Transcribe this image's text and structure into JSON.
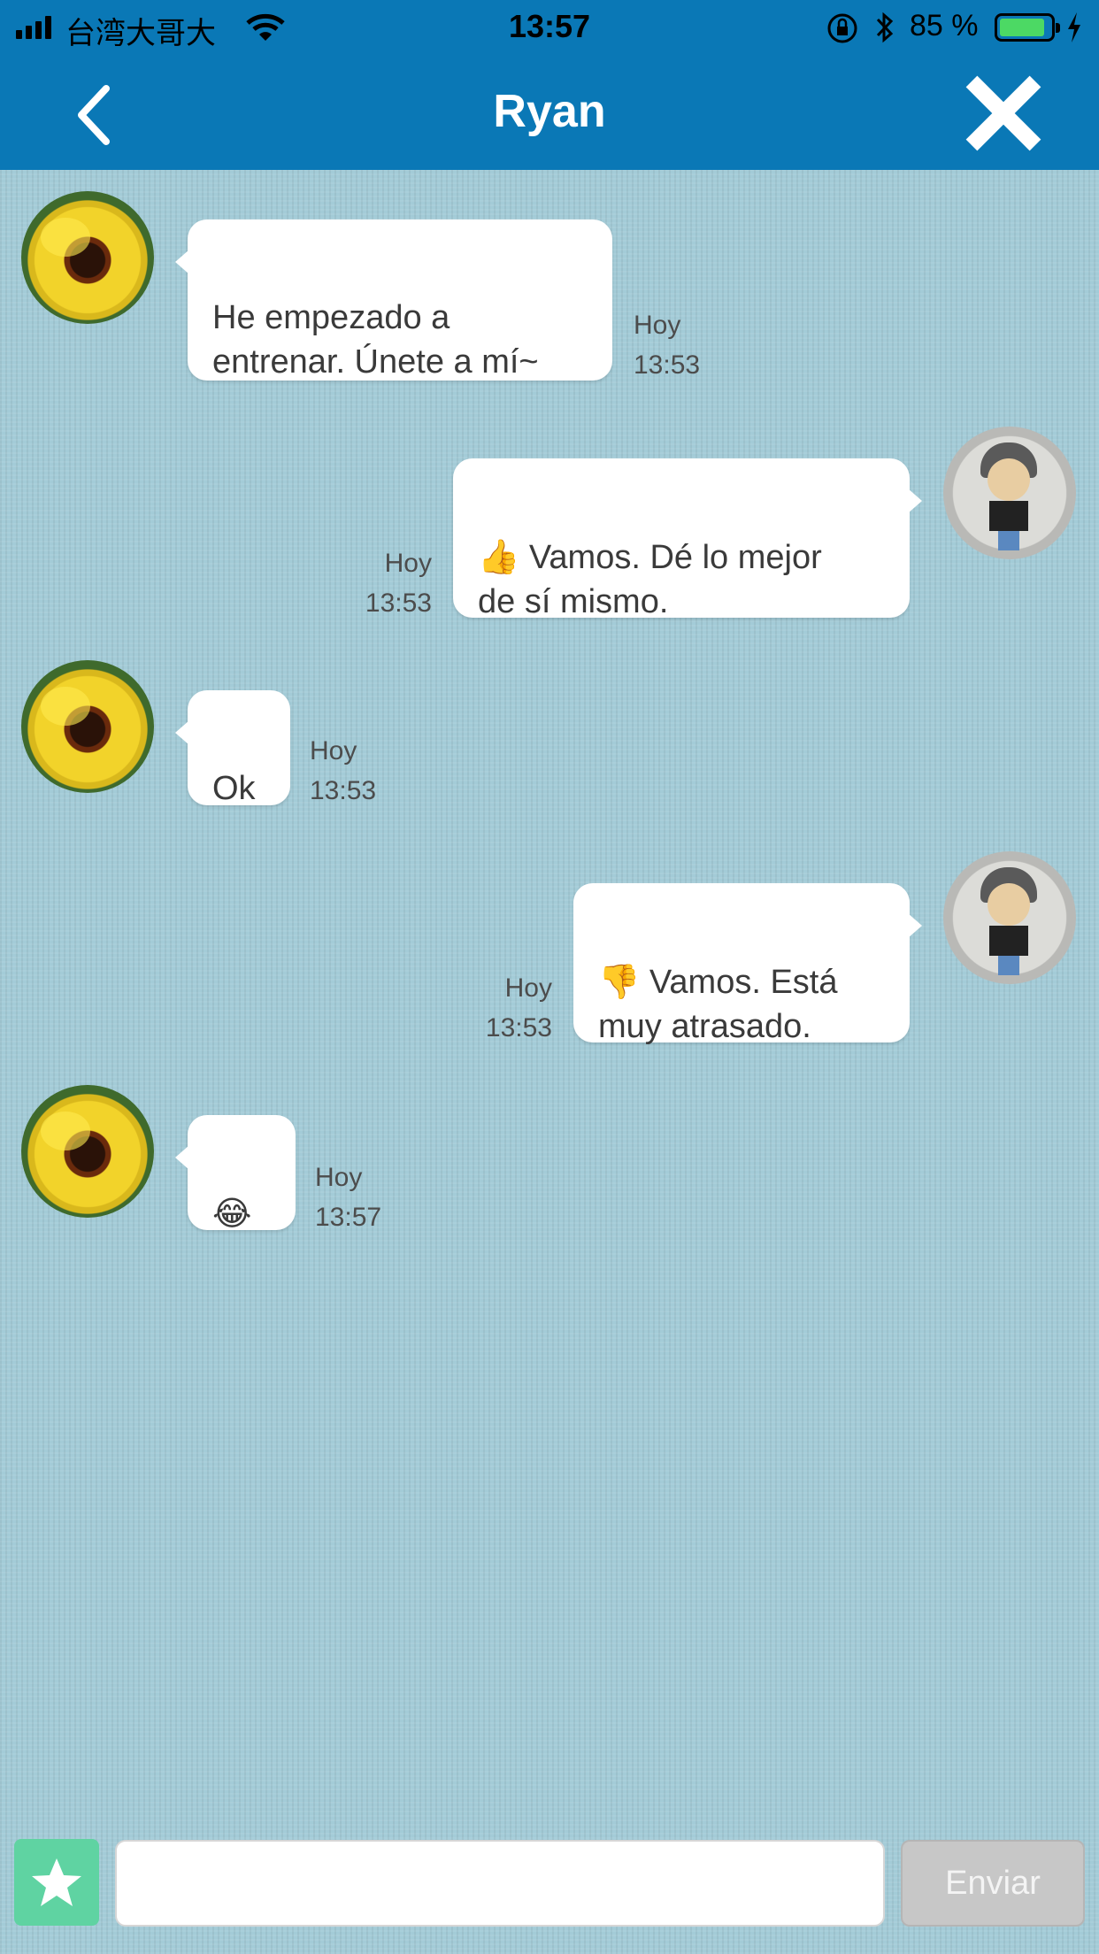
{
  "status_bar": {
    "carrier": "台湾大哥大",
    "time": "13:57",
    "battery_percent": "85 %",
    "battery_level": 0.85
  },
  "nav": {
    "title": "Ryan",
    "back_icon": "chevron-left-icon",
    "close_icon": "close-icon"
  },
  "messages": [
    {
      "side": "left",
      "avatar": "pansy-flower-avatar",
      "text": "He empezado a\nentrenar. Únete a mí~",
      "day": "Hoy",
      "time": "13:53"
    },
    {
      "side": "right",
      "avatar": "drawing-avatar",
      "emoji": "👍",
      "text": " Vamos. Dé lo mejor\nde sí mismo.",
      "day": "Hoy",
      "time": "13:53"
    },
    {
      "side": "left",
      "avatar": "pansy-flower-avatar",
      "text": "Ok",
      "day": "Hoy",
      "time": "13:53"
    },
    {
      "side": "right",
      "avatar": "drawing-avatar",
      "emoji": "👎",
      "text": " Vamos. Está\nmuy atrasado.",
      "day": "Hoy",
      "time": "13:53"
    },
    {
      "side": "left",
      "avatar": "pansy-flower-avatar",
      "emoji": "😂",
      "text": "",
      "day": "Hoy",
      "time": "13:57"
    }
  ],
  "composer": {
    "favorite_icon": "star-icon",
    "input_value": "",
    "send_label": "Enviar"
  },
  "colors": {
    "nav_bar": "#0a78b6",
    "chat_background": "#a3cbd7",
    "favorite_button": "#5fd3a2",
    "send_button": "#c7c7c7"
  }
}
